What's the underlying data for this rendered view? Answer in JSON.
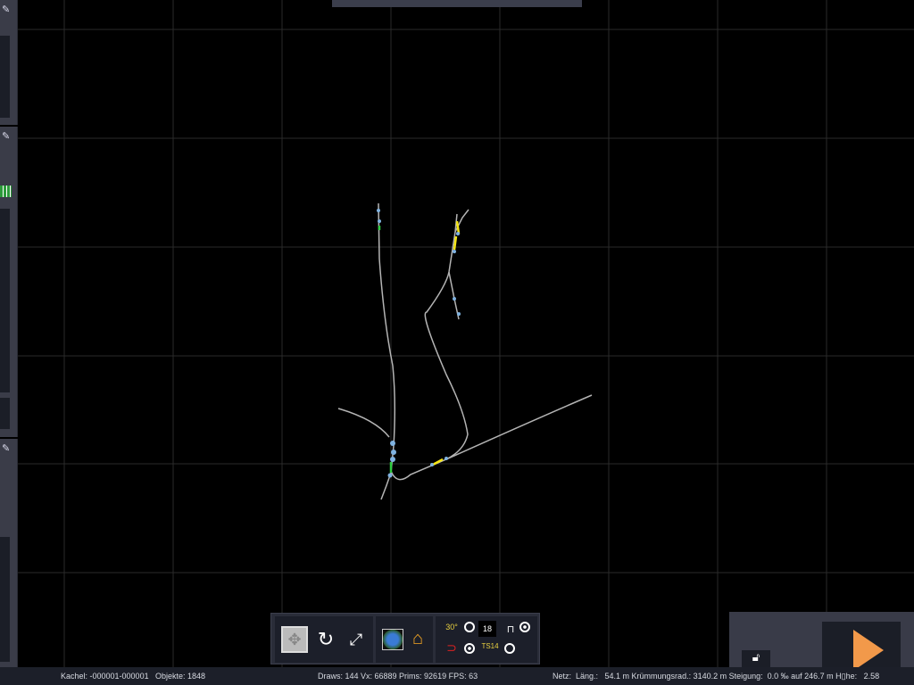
{
  "status": {
    "tile": "Kachel: -000001-000001",
    "objects": "Objekte: 1848",
    "render": "Draws: 144 Vx: 66889 Prims: 92619 FPS: 63",
    "net": "Netz:  Läng.:   54.1 m Krümmungsrad.: 3140.2 m Steigung:  0.0 ‰ auf 246.7 m H▯he:   2.58"
  },
  "toolbar": {
    "angle_label": "30°",
    "number_value": "18",
    "ts_label": "TS14"
  },
  "colors": {
    "track": "#b4b4b4",
    "node": "#7fb2e0",
    "highlight": "#f5e614",
    "green": "#2ecc40",
    "play": "#f2994a"
  }
}
